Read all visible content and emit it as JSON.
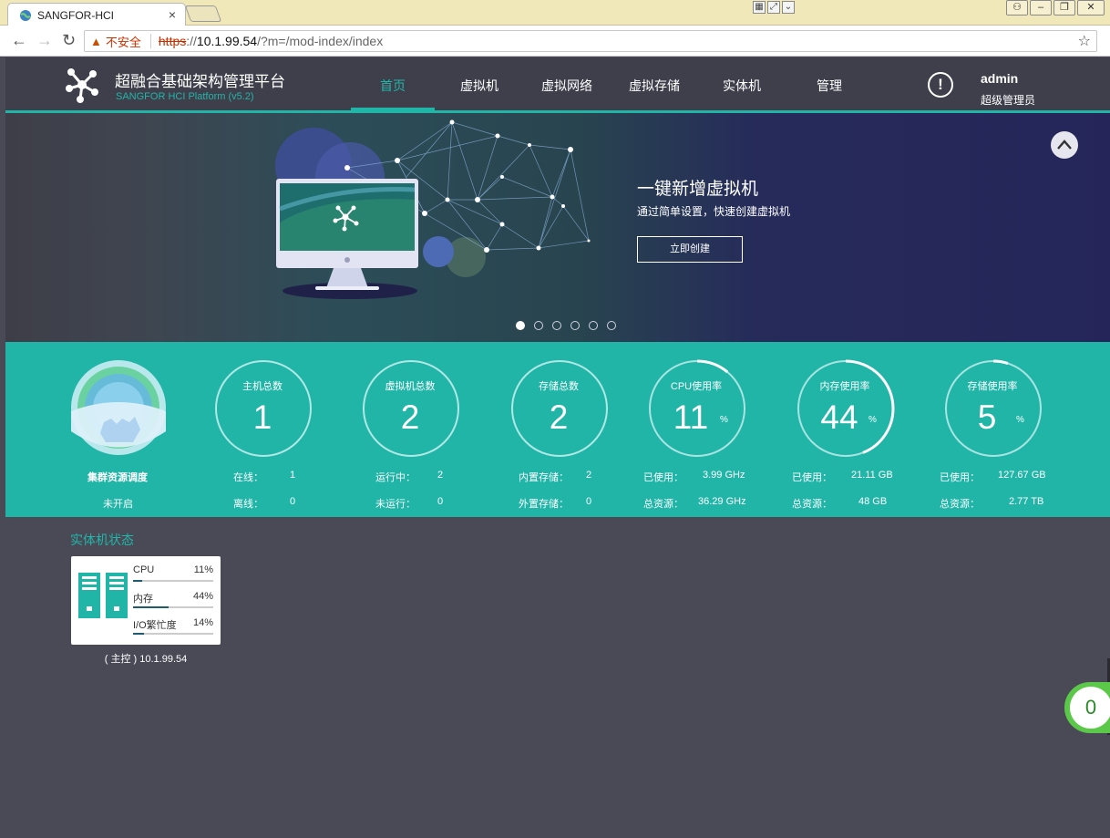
{
  "browser": {
    "tab_title": "SANGFOR-HCI",
    "tab_close": "×",
    "insecure_label": "不安全",
    "url_protocol": "https",
    "url_separator": "://",
    "url_host": "10.1.99.54",
    "url_path": "/?m=/mod-index/index"
  },
  "header": {
    "brand_cn": "超融合基础架构管理平台",
    "brand_en": "SANGFOR HCI Platform (v5.2)",
    "nav": [
      {
        "label": "首页",
        "active": true
      },
      {
        "label": "虚拟机"
      },
      {
        "label": "虚拟网络"
      },
      {
        "label": "虚拟存储"
      },
      {
        "label": "实体机"
      },
      {
        "label": "管理"
      }
    ],
    "alert_symbol": "!",
    "user": {
      "name": "admin",
      "role": "超级管理员"
    }
  },
  "banner": {
    "title": "一键新增虚拟机",
    "subtitle": "通过简单设置，快速创建虚拟机",
    "button": "立即创建",
    "slide_count": 6,
    "active_slide": 1
  },
  "stats": {
    "cluster": {
      "title": "集群资源调度",
      "status": "未开启"
    },
    "hosts": {
      "label": "主机总数",
      "value": "1",
      "row1_label": "在线：",
      "row1_value": "1",
      "row2_label": "离线：",
      "row2_value": "0"
    },
    "vms": {
      "label": "虚拟机总数",
      "value": "2",
      "row1_label": "运行中：",
      "row1_value": "2",
      "row2_label": "未运行：",
      "row2_value": "0"
    },
    "storage": {
      "label": "存储总数",
      "value": "2",
      "row1_label": "内置存储：",
      "row1_value": "2",
      "row2_label": "外置存储：",
      "row2_value": "0"
    },
    "cpu": {
      "label": "CPU使用率",
      "value": "11",
      "unit": "%",
      "row1_label": "已使用：",
      "row1_value": "3.99 GHz",
      "row2_label": "总资源：",
      "row2_value": "36.29 GHz"
    },
    "mem": {
      "label": "内存使用率",
      "value": "44",
      "unit": "%",
      "row1_label": "已使用：",
      "row1_value": "21.11 GB",
      "row2_label": "总资源：",
      "row2_value": "48 GB"
    },
    "disk": {
      "label": "存储使用率",
      "value": "5",
      "unit": "%",
      "row1_label": "已使用：",
      "row1_value": "127.67 GB",
      "row2_label": "总资源：",
      "row2_value": "2.77 TB"
    }
  },
  "hosts_section": {
    "title": "实体机状态",
    "host": {
      "name": "( 主控 ) 10.1.99.54",
      "metrics": [
        {
          "name": "CPU",
          "value": "11%",
          "percent": 11
        },
        {
          "name": "内存",
          "value": "44%",
          "percent": 44
        },
        {
          "name": "I/O繁忙度",
          "value": "14%",
          "percent": 14
        }
      ]
    }
  },
  "float_badge": {
    "value": "0"
  },
  "colors": {
    "accent": "#21b5a8",
    "header_bg": "#3f3f4b",
    "page_bg": "#4a4a56",
    "badge": "#5cc84a"
  }
}
